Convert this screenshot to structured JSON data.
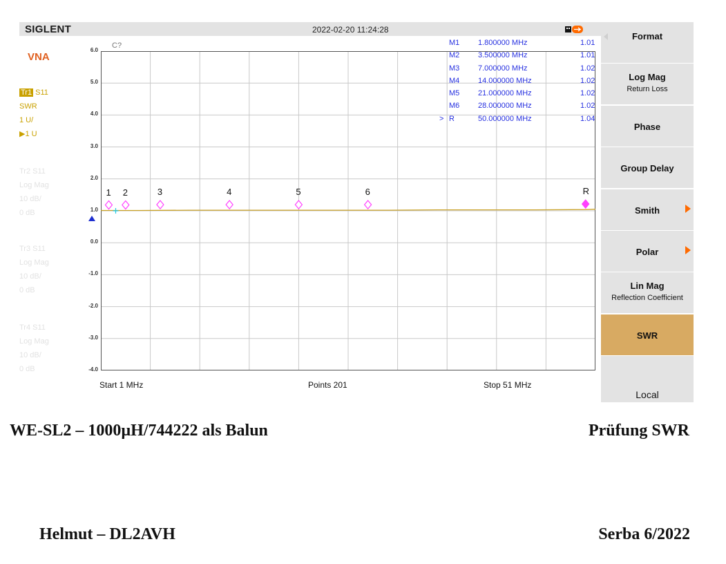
{
  "instrument": {
    "brand": "SIGLENT",
    "datetime": "2022-02-20 11:24:28",
    "mode": "VNA",
    "traces": [
      {
        "lines": [
          "Tr1 S11",
          "SWR",
          "1 U/",
          "▶1 U"
        ],
        "active": true
      },
      {
        "lines": [
          "Tr2 S11",
          "Log Mag",
          "10 dB/",
          "0 dB"
        ],
        "active": false
      },
      {
        "lines": [
          "Tr3 S11",
          "Log Mag",
          "10 dB/",
          "0 dB"
        ],
        "active": false
      },
      {
        "lines": [
          "Tr4 S11",
          "Log Mag",
          "10 dB/",
          "0 dB"
        ],
        "active": false
      }
    ]
  },
  "chart_data": {
    "type": "line",
    "channel_label": "C?",
    "ylim": [
      -4.0,
      6.0
    ],
    "y_ticks": [
      "6.0",
      "5.0",
      "4.0",
      "3.0",
      "2.0",
      "1.0",
      "0.0",
      "-1.0",
      "-2.0",
      "-3.0",
      "-4.0"
    ],
    "xlim_mhz": [
      1,
      51
    ],
    "grid": true,
    "series": [
      {
        "color": "#c9a227",
        "x": [
          1,
          5,
          10,
          15,
          20,
          25,
          30,
          35,
          40,
          45,
          50,
          51
        ],
        "y": [
          1.01,
          1.01,
          1.02,
          1.02,
          1.02,
          1.02,
          1.02,
          1.03,
          1.03,
          1.03,
          1.04,
          1.05
        ]
      }
    ],
    "markers": [
      {
        "id": "M1",
        "label": "1",
        "freq_mhz": 1.8,
        "freq_text": "1.800000 MHz",
        "value": "1.01",
        "y": 1.01
      },
      {
        "id": "M2",
        "label": "2",
        "freq_mhz": 3.5,
        "freq_text": "3.500000 MHz",
        "value": "1.01",
        "y": 1.01
      },
      {
        "id": "M3",
        "label": "3",
        "freq_mhz": 7.0,
        "freq_text": "7.000000 MHz",
        "value": "1.02",
        "y": 1.02
      },
      {
        "id": "M4",
        "label": "4",
        "freq_mhz": 14.0,
        "freq_text": "14.000000 MHz",
        "value": "1.02",
        "y": 1.02
      },
      {
        "id": "M5",
        "label": "5",
        "freq_mhz": 21.0,
        "freq_text": "21.000000 MHz",
        "value": "1.02",
        "y": 1.02
      },
      {
        "id": "M6",
        "label": "6",
        "freq_mhz": 28.0,
        "freq_text": "28.000000 MHz",
        "value": "1.02",
        "y": 1.02
      },
      {
        "id": "R",
        "label": "R",
        "freq_mhz": 50.0,
        "freq_text": "50.000000 MHz",
        "value": "1.04",
        "y": 1.04,
        "reference": true,
        "pointer": ">"
      }
    ],
    "reference_level": 1.0,
    "start_text": "Start  1 MHz",
    "points_text": "Points  201",
    "stop_text": "Stop  51 MHz"
  },
  "softkeys": [
    {
      "title": "Format",
      "sub": "",
      "arrow": false,
      "active": false,
      "back": true
    },
    {
      "title": "Log Mag",
      "sub": "Return Loss",
      "arrow": false,
      "active": false
    },
    {
      "title": "Phase",
      "sub": "",
      "arrow": false,
      "active": false
    },
    {
      "title": "Group Delay",
      "sub": "",
      "arrow": false,
      "active": false
    },
    {
      "title": "Smith",
      "sub": "",
      "arrow": true,
      "active": false
    },
    {
      "title": "Polar",
      "sub": "",
      "arrow": true,
      "active": false
    },
    {
      "title": "Lin Mag",
      "sub": "Reflection Coefficient",
      "arrow": false,
      "active": false
    },
    {
      "title": "SWR",
      "sub": "",
      "arrow": false,
      "active": true
    },
    {
      "title": "",
      "sub": "",
      "arrow": false,
      "active": false
    }
  ],
  "local_label": "Local",
  "colors": {
    "accent": "#d8aa62",
    "trace1": "#c9a100",
    "marker": "#ff40ff",
    "marker_text": "#2630e0",
    "brand_orange": "#e06020"
  },
  "captions": {
    "title_left": "WE-SL2 – 1000µH/744222 als Balun",
    "title_right": "Prüfung SWR",
    "footer_left": "Helmut – DL2AVH",
    "footer_right": "Serba 6/2022"
  }
}
